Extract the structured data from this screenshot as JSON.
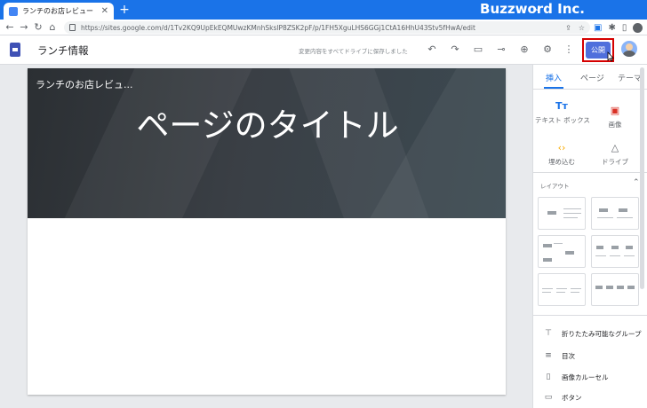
{
  "browser": {
    "tab_title": "ランチのお店レビュー",
    "url": "https://sites.google.com/d/1Tv2KQ9UpEkEQMUwzKMnhSkslP8ZSK2pF/p/1FH5XguLHS6GGj1CtA16HhU43Stv5fHwA/edit",
    "brand": "Buzzword Inc.",
    "icons": [
      "back-icon",
      "forward-icon",
      "reload-icon",
      "home-icon",
      "lock-icon",
      "share-icon",
      "star-icon",
      "extension-icon",
      "puzzle-icon",
      "sidepanel-icon",
      "profile-icon",
      "menu-icon"
    ]
  },
  "toolbar": {
    "site_title": "ランチ情報",
    "save_status": "変更内容をすべてドライブに保存しました",
    "publish_label": "公開",
    "publish_tooltip": "公開",
    "accent": "#4f6fdc",
    "highlight_color": "#d50000"
  },
  "page": {
    "site_name": "ランチのお店レビュ...",
    "title": "ページのタイトル"
  },
  "panel": {
    "tabs": [
      "挿入",
      "ページ",
      "テーマ"
    ],
    "active_tab": "挿入",
    "insert_items": [
      {
        "label": "テキスト ボックス",
        "icon": "text-box-icon"
      },
      {
        "label": "画像",
        "icon": "image-icon"
      },
      {
        "label": "埋め込む",
        "icon": "embed-icon"
      },
      {
        "label": "ドライブ",
        "icon": "drive-icon"
      }
    ],
    "layout_label": "レイアウト",
    "list_items": [
      {
        "label": "折りたたみ可能なグループ",
        "icon": "collapsible-group-icon"
      },
      {
        "label": "目次",
        "icon": "toc-icon"
      },
      {
        "label": "画像カルーセル",
        "icon": "carousel-icon"
      },
      {
        "label": "ボタン",
        "icon": "button-icon"
      }
    ]
  }
}
